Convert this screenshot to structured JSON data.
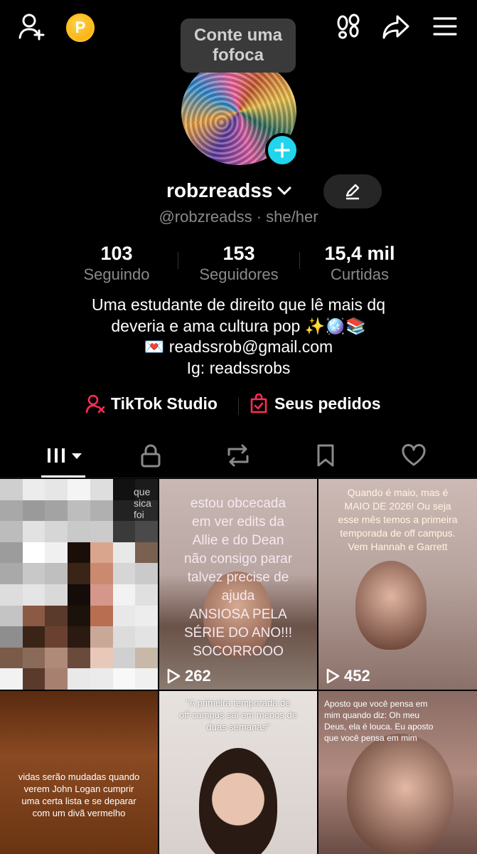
{
  "tooltip": {
    "text": "Conte uma fofoca"
  },
  "coin": {
    "letter": "P",
    "color": "#f5a400"
  },
  "profile": {
    "username": "robzreadss",
    "handle": "@robzreadss · she/her",
    "stats": [
      {
        "value": "103",
        "label": "Seguindo"
      },
      {
        "value": "153",
        "label": "Seguidores"
      },
      {
        "value": "15,4 mil",
        "label": "Curtidas"
      }
    ],
    "bio": [
      "Uma estudante de direito que lê mais dq",
      "deveria e ama cultura pop ✨🪩📚",
      "💌 readssrob@gmail.com",
      "Ig: readssrobs"
    ]
  },
  "links": {
    "studio": "TikTok Studio",
    "orders": "Seus pedidos",
    "accent": "#fe2c55"
  },
  "tabs": [
    "videos-grid-icon",
    "lock-icon",
    "repost-icon",
    "bookmark-icon",
    "heart-icon"
  ],
  "videos": [
    {
      "text": "que\nsica\nfoi",
      "views": ""
    },
    {
      "text": "estou obcecada\nem ver edits da\nAllie e do Dean\nnão consigo parar\ntalvez precise de\najuda\nANSIOSA PELA\nSÉRIE DO ANO!!!\nSOCORROOO",
      "views": "262"
    },
    {
      "text": "Quando é maio, mas é\nMAIO DE 2026! Ou seja\nesse mês temos a primeira\ntemporada de off campus.\nVem Hannah e Garrett",
      "views": "452"
    },
    {
      "text": "vidas serão mudadas quando\nverem John Logan cumprir\numa certa lista e se deparar\ncom um divã vermelho",
      "views": ""
    },
    {
      "text": "\"A primeira temporada de\noff campus sai em menos de\nduas semanas\"",
      "views": ""
    },
    {
      "text": "Aposto que você pensa em\nmim quando diz: Oh meu\nDeus, ela é louca. Eu aposto\nque você pensa em mim",
      "views": ""
    }
  ]
}
